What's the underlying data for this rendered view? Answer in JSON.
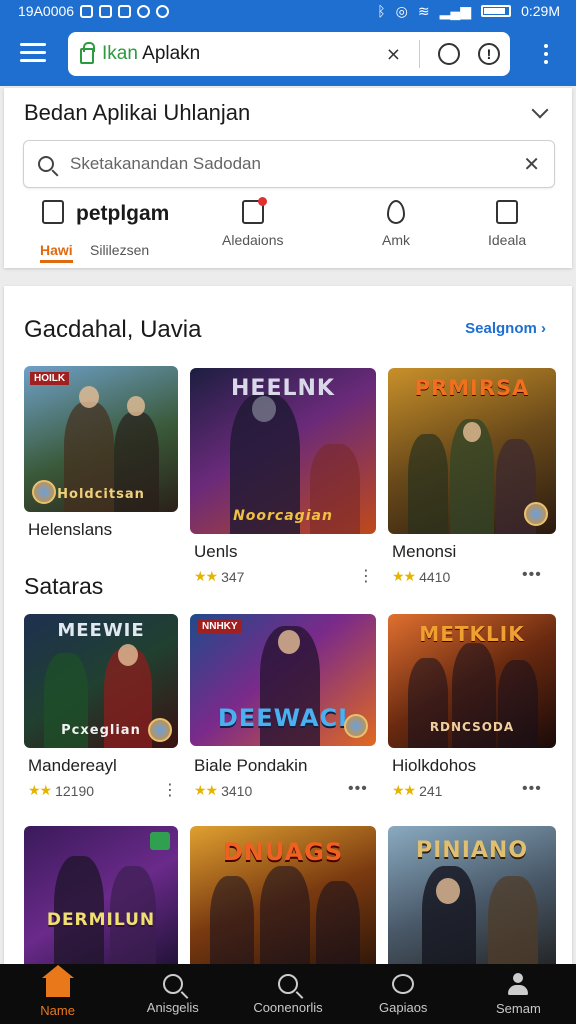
{
  "status": {
    "left_text": "19A0006",
    "time": "0:29M"
  },
  "browser": {
    "url_green": "Ikan",
    "url_rest": " Aplakn",
    "clear": "✕"
  },
  "top": {
    "title": "Bedan Aplikai Uhlanjan",
    "search_placeholder": "Sketakanandan Sadodan",
    "category_bold": "petplgam",
    "cat_active": "Hawi",
    "cat_sub": "Sililezsen",
    "categories": [
      "Aledaions",
      "Amk",
      "Ideala"
    ]
  },
  "section1": {
    "title": "Gacdahal, Uavia",
    "see_all": "Sealgnom"
  },
  "section2": {
    "title": "Sataras"
  },
  "apps": [
    {
      "name": "Helenslans",
      "logo": "Holdcitsan",
      "tag": "HOILK"
    },
    {
      "name": "Uenls",
      "rating": "347",
      "logo": "HEELNK",
      "sublogo": "Noorcagian"
    },
    {
      "name": "Menonsi",
      "rating": "4410",
      "logo": "PRMIRSA"
    },
    {
      "name": "Mandereayl",
      "rating": "12190",
      "logo": "MEEWIE",
      "sublogo": "Pcxeglian"
    },
    {
      "name": "Biale Pondakin",
      "rating": "3410",
      "logo": "DEEWACI",
      "tag": "NNHKY"
    },
    {
      "name": "Hiolkdohos",
      "rating": "241",
      "logo": "METKLIK",
      "sublogo": "RDNCSODA"
    },
    {
      "logo": "DERMILUN"
    },
    {
      "logo": "DNUAGS"
    },
    {
      "logo": "PINIANO"
    }
  ],
  "nav": [
    "Name",
    "Anisgelis",
    "Coonenorlis",
    "Gapiaos",
    "Semam"
  ],
  "colors": {
    "primary": "#1e6fd0",
    "accent": "#e8781a",
    "star": "#e6b400"
  }
}
